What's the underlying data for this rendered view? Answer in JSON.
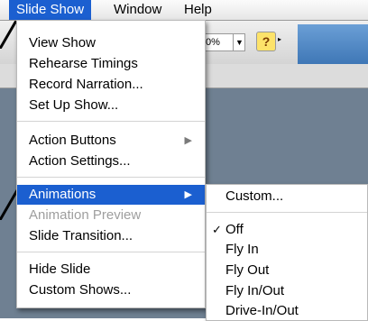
{
  "menubar": {
    "items": [
      {
        "label": "Slide Show",
        "active": true
      },
      {
        "label": "Window",
        "active": false
      },
      {
        "label": "Help",
        "active": false
      }
    ]
  },
  "toolbar": {
    "zoom_value": "0%",
    "help_glyph": "?"
  },
  "slide_show_menu": {
    "items": [
      {
        "label": "View Show"
      },
      {
        "label": "Rehearse Timings"
      },
      {
        "label": "Record Narration..."
      },
      {
        "label": "Set Up Show..."
      },
      {
        "label": "Action Buttons",
        "submenu": true
      },
      {
        "label": "Action Settings..."
      },
      {
        "label": "Animations",
        "submenu": true,
        "highlighted": true
      },
      {
        "label": "Animation Preview",
        "disabled": true
      },
      {
        "label": "Slide Transition..."
      },
      {
        "label": "Hide Slide"
      },
      {
        "label": "Custom Shows..."
      }
    ],
    "submenu_arrow": "▶"
  },
  "animations_submenu": {
    "items": [
      {
        "label": "Custom..."
      },
      {
        "label": "Off",
        "checked": true
      },
      {
        "label": "Fly In"
      },
      {
        "label": "Fly Out"
      },
      {
        "label": "Fly In/Out"
      },
      {
        "label": "Drive-In/Out"
      }
    ],
    "check_glyph": "✓"
  },
  "colors": {
    "highlight": "#1b5fd0",
    "disabled_text": "#9e9e9e"
  }
}
